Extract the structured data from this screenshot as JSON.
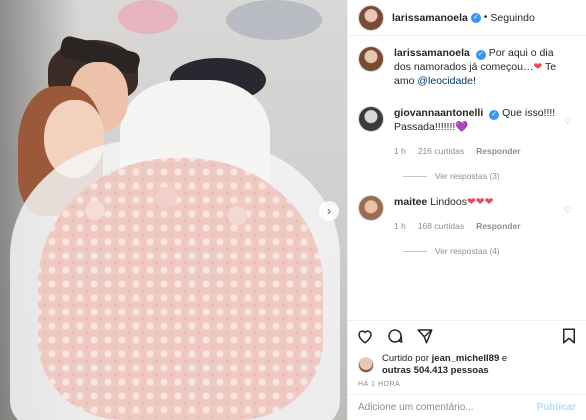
{
  "header": {
    "username": "larissamanoela",
    "follow_status": "Seguindo"
  },
  "caption": {
    "username": "larissamanoela",
    "text": "Por aqui o dia dos namorados já começou…",
    "text_after": " Te amo",
    "mention": "@leocidade",
    "end": "!"
  },
  "comments": [
    {
      "username": "giovannaantonelli",
      "text": "Que isso!!!! Passada!!!!!!!",
      "time": "1 h",
      "likes": "216 curtidas",
      "reply": "Responder",
      "view_replies": "Ver respostas (3)"
    },
    {
      "username": "maitee",
      "text": "Lindoos",
      "time": "1 h",
      "likes": "168 curtidas",
      "reply": "Responder",
      "view_replies": "Ver respostas (4)"
    }
  ],
  "likes": {
    "prefix": "Curtido por",
    "user": "jean_michell89",
    "mid": " e",
    "others": "outras 504.413 pessoas"
  },
  "timestamp": "HÁ 1 HORA",
  "add_comment": {
    "placeholder": "Adicione um comentário...",
    "publish": "Publicar"
  },
  "colors": {
    "link": "#00376b",
    "verified": "#3897f0",
    "heart": "#ed4956"
  }
}
